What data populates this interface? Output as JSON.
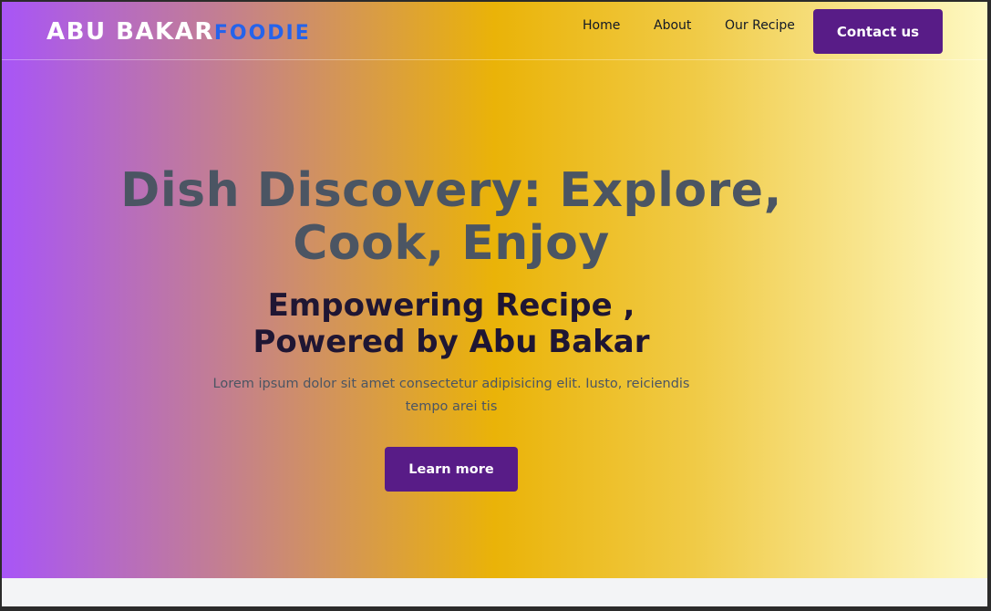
{
  "navbar": {
    "brand_main": "ABU BAKAR",
    "brand_accent": "FOODIE",
    "links": [
      "Home",
      "About",
      "Our Recipe"
    ],
    "contact_label": "Contact us"
  },
  "hero": {
    "title": "Dish Discovery: Explore, Cook, Enjoy",
    "subtitle": "Empowering Recipe , Powered by Abu Bakar",
    "description": "Lorem ipsum dolor sit amet consectetur adipisicing elit. Iusto, reiciendis tempo arei tis",
    "cta_label": "Learn more"
  },
  "colors": {
    "brand_accent": "#2563eb",
    "button_bg": "#581c87",
    "gradient_start": "#a855f7",
    "gradient_mid": "#eab308",
    "gradient_end": "#fef9c3"
  }
}
